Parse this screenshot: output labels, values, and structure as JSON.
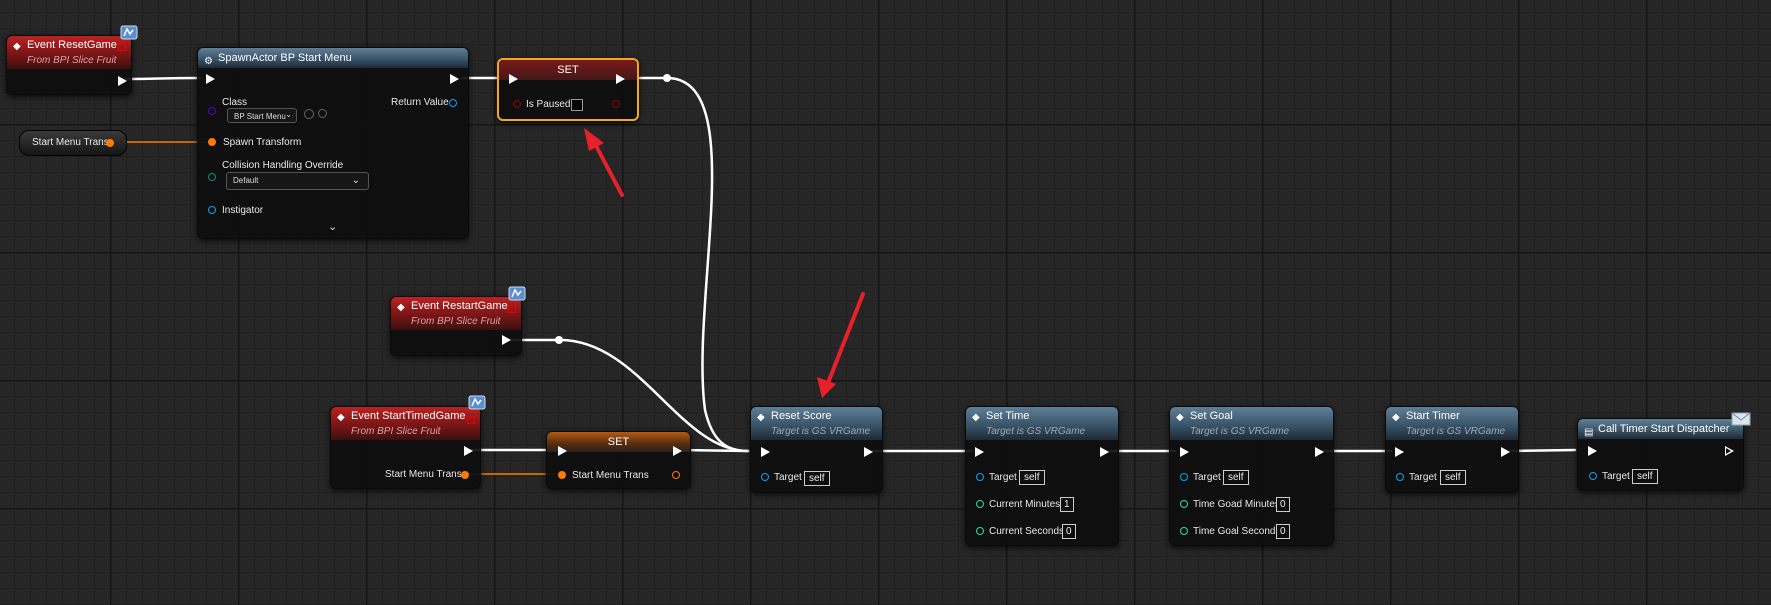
{
  "graph": {
    "event_reset": {
      "title": "Event ResetGame",
      "subtitle": "From BPI Slice Fruit"
    },
    "spawn": {
      "title": "SpawnActor BP Start Menu",
      "class_label": "Class",
      "class_value": "BP Start Menu",
      "return_label": "Return Value",
      "transform_label": "Spawn Transform",
      "collision_label": "Collision Handling Override",
      "collision_value": "Default",
      "instigator_label": "Instigator"
    },
    "var_start_menu_trans_1": {
      "label": "Start Menu Trans"
    },
    "set_paused": {
      "title": "SET",
      "pin_label": "Is Paused",
      "value": false
    },
    "event_restart": {
      "title": "Event RestartGame",
      "subtitle": "From BPI Slice Fruit"
    },
    "event_timed": {
      "title": "Event StartTimedGame",
      "subtitle": "From BPI Slice Fruit",
      "out_label": "Start Menu Trans"
    },
    "set_trans": {
      "title": "SET",
      "pin_label": "Start Menu Trans"
    },
    "reset_score": {
      "title": "Reset Score",
      "subtitle": "Target is GS VRGame",
      "target_label": "Target",
      "target_value": "self"
    },
    "set_time": {
      "title": "Set Time",
      "subtitle": "Target is GS VRGame",
      "target_label": "Target",
      "target_value": "self",
      "minutes_label": "Current Minutes",
      "minutes_value": "1",
      "seconds_label": "Current Seconds",
      "seconds_value": "0"
    },
    "set_goal": {
      "title": "Set Goal",
      "subtitle": "Target is GS VRGame",
      "target_label": "Target",
      "target_value": "self",
      "minutes_label": "Time Goad Minutes",
      "minutes_value": "0",
      "seconds_label": "Time Goal Seconds",
      "seconds_value": "0"
    },
    "start_timer": {
      "title": "Start Timer",
      "subtitle": "Target is GS VRGame",
      "target_label": "Target",
      "target_value": "self"
    },
    "call_timer": {
      "title": "Call Timer Start Dispatcher",
      "target_label": "Target",
      "target_value": "self"
    }
  },
  "colors": {
    "exec": "#ffffff",
    "struct": "#ff7a00",
    "object": "#00a8f3",
    "bool": "#950000",
    "int": "#1fe3af",
    "class": "#5a00c8",
    "annotation": "#e8202a",
    "selection": "#f5a623"
  },
  "icons": [
    "event-icon",
    "function-icon",
    "spawn-icon",
    "dispatcher-icon",
    "interface-badge-icon",
    "envelope-icon",
    "chevron-down-icon"
  ]
}
